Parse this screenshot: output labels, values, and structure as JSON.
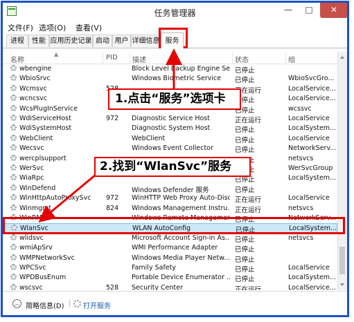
{
  "window": {
    "title": "任务管理器",
    "min": "—",
    "max": "□",
    "close": "✕"
  },
  "menu": [
    "文件(F)",
    "选项(O)",
    "查看(V)"
  ],
  "tabs": [
    "进程",
    "性能",
    "应用历史记录",
    "启动",
    "用户",
    "详细信息",
    "服务"
  ],
  "active_tab": "服务",
  "columns": {
    "name": "名称",
    "pid": "PID",
    "desc": "描述",
    "status": "状态",
    "group": "组"
  },
  "rows": [
    {
      "name": "wbengine",
      "pid": "",
      "desc": "Block Level Backup Engine Se...",
      "status": "已停止",
      "group": ""
    },
    {
      "name": "WbioSrvc",
      "pid": "",
      "desc": "Windows Biometric Service",
      "status": "已停止",
      "group": "WbioSvcGro..."
    },
    {
      "name": "Wcmsvc",
      "pid": "528",
      "desc": "",
      "status": "正在运行",
      "group": "LocalService..."
    },
    {
      "name": "wcncsvc",
      "pid": "",
      "desc": "",
      "status": "已停止",
      "group": "LocalService..."
    },
    {
      "name": "WcsPlugInService",
      "pid": "",
      "desc": "",
      "status": "已停止",
      "group": "wcssvc"
    },
    {
      "name": "WdiServiceHost",
      "pid": "972",
      "desc": "Diagnostic Service Host",
      "status": "正在运行",
      "group": "LocalService"
    },
    {
      "name": "WdiSystemHost",
      "pid": "",
      "desc": "Diagnostic System Host",
      "status": "已停止",
      "group": "LocalSystem..."
    },
    {
      "name": "WebClient",
      "pid": "",
      "desc": "WebClient",
      "status": "已停止",
      "group": "LocalService"
    },
    {
      "name": "Wecsvc",
      "pid": "",
      "desc": "Windows Event Collector",
      "status": "已停止",
      "group": "NetworkServ..."
    },
    {
      "name": "wercplsupport",
      "pid": "",
      "desc": "",
      "status": "已停止",
      "group": "netsvcs"
    },
    {
      "name": "WerSvc",
      "pid": "",
      "desc": "",
      "status": "已停止",
      "group": "WerSvcGroup"
    },
    {
      "name": "WiaRpc",
      "pid": "",
      "desc": "",
      "status": "已停止",
      "group": "LocalSystem..."
    },
    {
      "name": "WinDefend",
      "pid": "",
      "desc": "Windows Defender 服务",
      "status": "已停止",
      "group": ""
    },
    {
      "name": "WinHttpAutoProxySvc",
      "pid": "972",
      "desc": "WinHTTP Web Proxy Auto-Disc...",
      "status": "正在运行",
      "group": "LocalService"
    },
    {
      "name": "Winmgmt",
      "pid": "824",
      "desc": "Windows Management Instru...",
      "status": "正在运行",
      "group": "netsvcs"
    },
    {
      "name": "WinRM",
      "pid": "",
      "desc": "Windows Remote Management",
      "status": "已停止",
      "group": "NetworkServ..."
    },
    {
      "name": "WlanSvc",
      "pid": "",
      "desc": "WLAN AutoConfig",
      "status": "已停止",
      "group": "LocalSystem..."
    },
    {
      "name": "wlidsvc",
      "pid": "",
      "desc": "Microsoft Account Sign-in As...",
      "status": "已停止",
      "group": "netsvcs"
    },
    {
      "name": "wmiApSrv",
      "pid": "",
      "desc": "WMI Performance Adapter",
      "status": "已停止",
      "group": ""
    },
    {
      "name": "WMPNetworkSvc",
      "pid": "",
      "desc": "Windows Media Player Netw...",
      "status": "已停止",
      "group": ""
    },
    {
      "name": "WPCSvc",
      "pid": "",
      "desc": "Family Safety",
      "status": "已停止",
      "group": "LocalService"
    },
    {
      "name": "WPDBusEnum",
      "pid": "",
      "desc": "Portable Device Enumerator ...",
      "status": "已停止",
      "group": "LocalSystem..."
    },
    {
      "name": "wscsvc",
      "pid": "528",
      "desc": "Security Center",
      "status": "正在运行",
      "group": "LocalService..."
    }
  ],
  "selected_row": "WlanSvc",
  "status_bar": {
    "less_details": "简略信息(D)",
    "open_services": "打开服务"
  },
  "callouts": {
    "step1": "1.点击“服务”选项卡",
    "step2": "2.找到“WlanSvc”服务"
  },
  "colors": {
    "annotation": "#e30000",
    "frame": "#1c51c8",
    "selection": "#cde8f7"
  }
}
